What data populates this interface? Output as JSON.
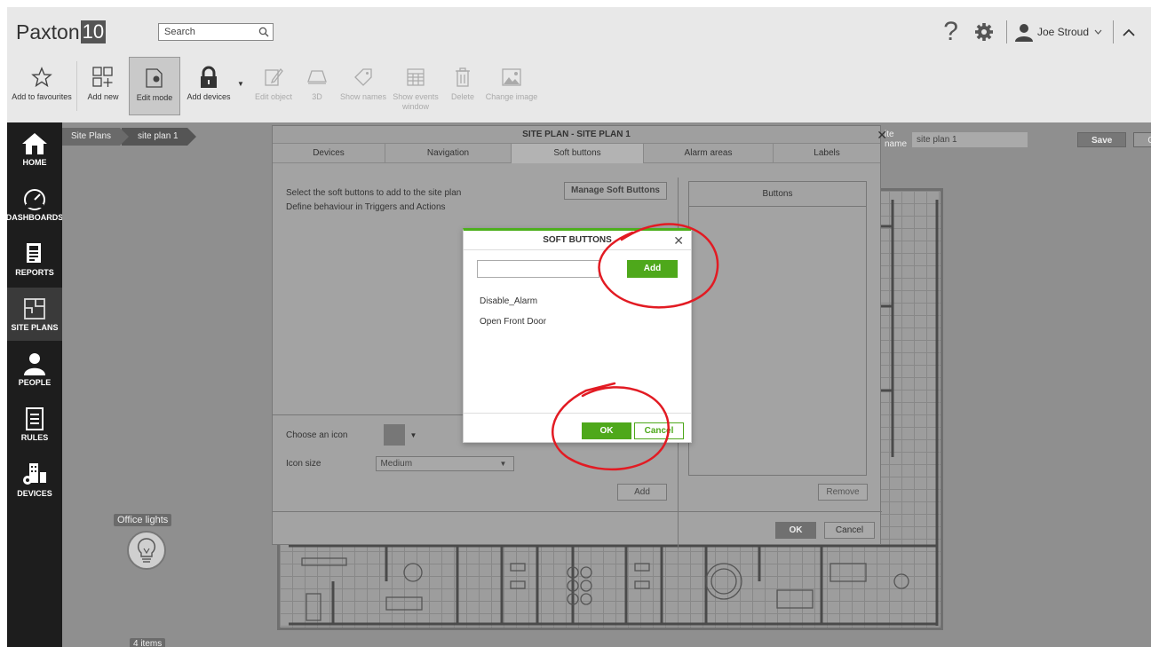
{
  "header": {
    "logo_text": "Paxton",
    "logo_number": "10",
    "search_label": "Search",
    "help_glyph": "?",
    "user_name": "Joe Stroud"
  },
  "toolbar": [
    {
      "label": "Add to favourites",
      "icon": "star-icon",
      "state": "enabled"
    },
    {
      "label": "Add new",
      "icon": "add-new-icon",
      "state": "enabled"
    },
    {
      "label": "Edit mode",
      "icon": "edit-mode-icon",
      "state": "active"
    },
    {
      "label": "Add devices",
      "icon": "lock-icon",
      "state": "enabled"
    },
    {
      "label": "Edit object",
      "icon": "pencil-icon",
      "state": "disabled"
    },
    {
      "label": "3D",
      "icon": "3d-icon",
      "state": "disabled"
    },
    {
      "label": "Show names",
      "icon": "tag-icon",
      "state": "disabled"
    },
    {
      "label": "Show events window",
      "icon": "events-icon",
      "state": "disabled"
    },
    {
      "label": "Delete",
      "icon": "trash-icon",
      "state": "disabled"
    },
    {
      "label": "Change image",
      "icon": "image-icon",
      "state": "disabled"
    }
  ],
  "leftnav": [
    {
      "label": "HOME",
      "icon": "home-icon"
    },
    {
      "label": "DASHBOARDS",
      "icon": "gauge-icon"
    },
    {
      "label": "REPORTS",
      "icon": "reports-icon"
    },
    {
      "label": "SITE PLANS",
      "icon": "site-plans-icon",
      "active": true
    },
    {
      "label": "PEOPLE",
      "icon": "person-icon"
    },
    {
      "label": "RULES",
      "icon": "rules-icon"
    },
    {
      "label": "DEVICES",
      "icon": "devices-icon"
    }
  ],
  "breadcrumb": [
    "Site Plans",
    "site plan 1"
  ],
  "edit_name": {
    "label": "ite name",
    "value": "site plan 1",
    "save_label": "Save",
    "close_label": "Close"
  },
  "canvas": {
    "light_label": "Office lights",
    "items_count": "4 items"
  },
  "site_plan_dialog": {
    "title": "SITE PLAN - SITE PLAN 1",
    "close_glyph": "✕",
    "tabs": [
      "Devices",
      "Navigation",
      "Soft buttons",
      "Alarm areas",
      "Labels"
    ],
    "active_tab": "Soft buttons",
    "instruction_1": "Select the soft buttons to add to the site plan",
    "instruction_2": "Define behaviour in Triggers and Actions",
    "manage_label": "Manage Soft Buttons",
    "buttons_panel_title": "Buttons",
    "choose_icon_label": "Choose an icon",
    "icon_size_label": "Icon size",
    "icon_size_value": "Medium",
    "add_label": "Add",
    "remove_label": "Remove",
    "ok_label": "OK",
    "cancel_label": "Cancel"
  },
  "soft_buttons_modal": {
    "title": "SOFT BUTTONS",
    "close_glyph": "✕",
    "input_value": "",
    "add_label": "Add",
    "items": [
      "Disable_Alarm",
      "Open Front Door"
    ],
    "ok_label": "OK",
    "cancel_label": "Cancel"
  },
  "colors": {
    "accent_green": "#4ea81b",
    "annotation_red": "#e21b23",
    "nav_dark": "#1d1d1d"
  }
}
